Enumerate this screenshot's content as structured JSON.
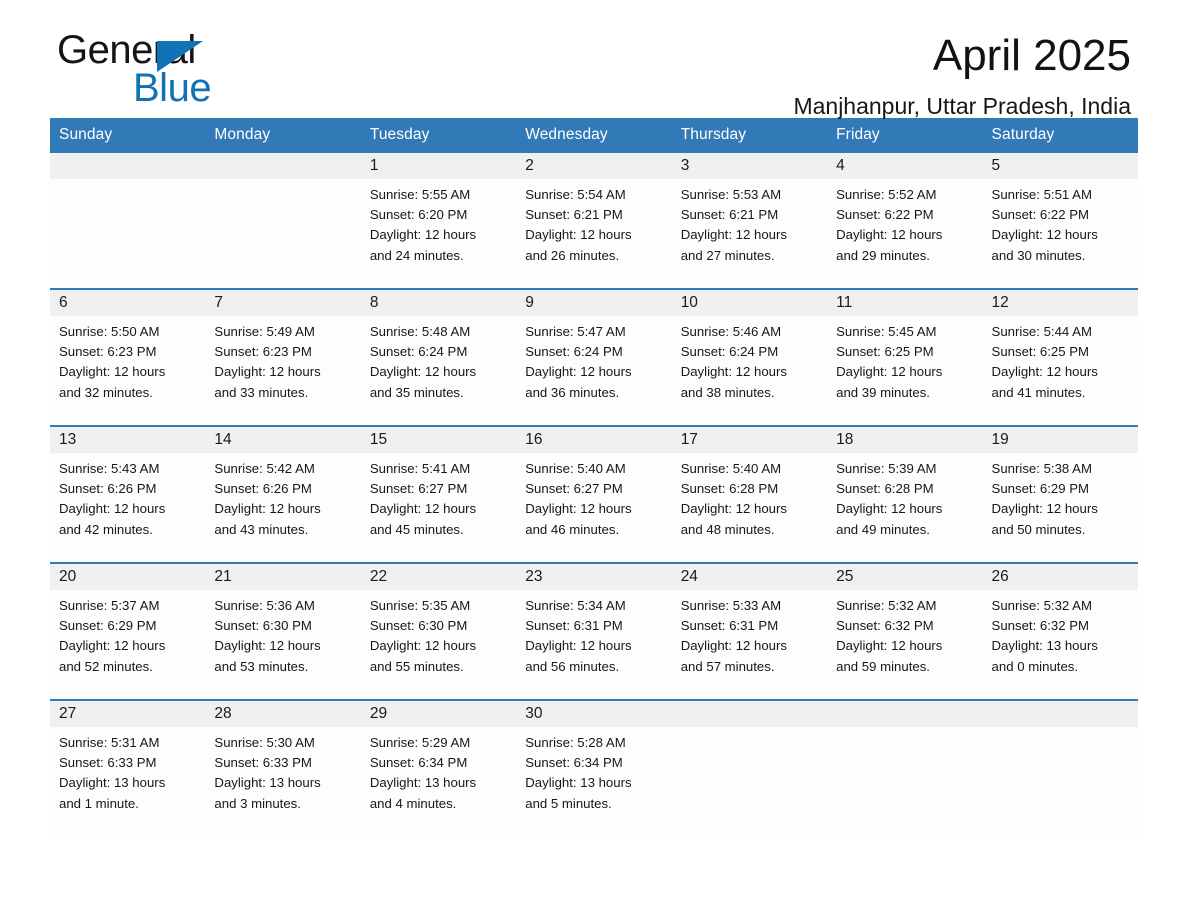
{
  "brand": {
    "name_part1": "General",
    "name_part2": "Blue",
    "flag_icon": "triangle-flag-icon",
    "accent_color": "#1272b6"
  },
  "header": {
    "month_title": "April 2025",
    "location": "Manjhanpur, Uttar Pradesh, India"
  },
  "theme": {
    "header_blue": "#3279b7",
    "daynum_band": "#f0f0f0",
    "cell_background": "#fdfdfd",
    "text": "#171717"
  },
  "calendar": {
    "weekday_headers": [
      "Sunday",
      "Monday",
      "Tuesday",
      "Wednesday",
      "Thursday",
      "Friday",
      "Saturday"
    ],
    "weeks": [
      [
        {
          "day": "",
          "sunrise": "",
          "sunset": "",
          "daylight_line1": "",
          "daylight_line2": ""
        },
        {
          "day": "",
          "sunrise": "",
          "sunset": "",
          "daylight_line1": "",
          "daylight_line2": ""
        },
        {
          "day": "1",
          "sunrise": "Sunrise: 5:55 AM",
          "sunset": "Sunset: 6:20 PM",
          "daylight_line1": "Daylight: 12 hours",
          "daylight_line2": "and 24 minutes."
        },
        {
          "day": "2",
          "sunrise": "Sunrise: 5:54 AM",
          "sunset": "Sunset: 6:21 PM",
          "daylight_line1": "Daylight: 12 hours",
          "daylight_line2": "and 26 minutes."
        },
        {
          "day": "3",
          "sunrise": "Sunrise: 5:53 AM",
          "sunset": "Sunset: 6:21 PM",
          "daylight_line1": "Daylight: 12 hours",
          "daylight_line2": "and 27 minutes."
        },
        {
          "day": "4",
          "sunrise": "Sunrise: 5:52 AM",
          "sunset": "Sunset: 6:22 PM",
          "daylight_line1": "Daylight: 12 hours",
          "daylight_line2": "and 29 minutes."
        },
        {
          "day": "5",
          "sunrise": "Sunrise: 5:51 AM",
          "sunset": "Sunset: 6:22 PM",
          "daylight_line1": "Daylight: 12 hours",
          "daylight_line2": "and 30 minutes."
        }
      ],
      [
        {
          "day": "6",
          "sunrise": "Sunrise: 5:50 AM",
          "sunset": "Sunset: 6:23 PM",
          "daylight_line1": "Daylight: 12 hours",
          "daylight_line2": "and 32 minutes."
        },
        {
          "day": "7",
          "sunrise": "Sunrise: 5:49 AM",
          "sunset": "Sunset: 6:23 PM",
          "daylight_line1": "Daylight: 12 hours",
          "daylight_line2": "and 33 minutes."
        },
        {
          "day": "8",
          "sunrise": "Sunrise: 5:48 AM",
          "sunset": "Sunset: 6:24 PM",
          "daylight_line1": "Daylight: 12 hours",
          "daylight_line2": "and 35 minutes."
        },
        {
          "day": "9",
          "sunrise": "Sunrise: 5:47 AM",
          "sunset": "Sunset: 6:24 PM",
          "daylight_line1": "Daylight: 12 hours",
          "daylight_line2": "and 36 minutes."
        },
        {
          "day": "10",
          "sunrise": "Sunrise: 5:46 AM",
          "sunset": "Sunset: 6:24 PM",
          "daylight_line1": "Daylight: 12 hours",
          "daylight_line2": "and 38 minutes."
        },
        {
          "day": "11",
          "sunrise": "Sunrise: 5:45 AM",
          "sunset": "Sunset: 6:25 PM",
          "daylight_line1": "Daylight: 12 hours",
          "daylight_line2": "and 39 minutes."
        },
        {
          "day": "12",
          "sunrise": "Sunrise: 5:44 AM",
          "sunset": "Sunset: 6:25 PM",
          "daylight_line1": "Daylight: 12 hours",
          "daylight_line2": "and 41 minutes."
        }
      ],
      [
        {
          "day": "13",
          "sunrise": "Sunrise: 5:43 AM",
          "sunset": "Sunset: 6:26 PM",
          "daylight_line1": "Daylight: 12 hours",
          "daylight_line2": "and 42 minutes."
        },
        {
          "day": "14",
          "sunrise": "Sunrise: 5:42 AM",
          "sunset": "Sunset: 6:26 PM",
          "daylight_line1": "Daylight: 12 hours",
          "daylight_line2": "and 43 minutes."
        },
        {
          "day": "15",
          "sunrise": "Sunrise: 5:41 AM",
          "sunset": "Sunset: 6:27 PM",
          "daylight_line1": "Daylight: 12 hours",
          "daylight_line2": "and 45 minutes."
        },
        {
          "day": "16",
          "sunrise": "Sunrise: 5:40 AM",
          "sunset": "Sunset: 6:27 PM",
          "daylight_line1": "Daylight: 12 hours",
          "daylight_line2": "and 46 minutes."
        },
        {
          "day": "17",
          "sunrise": "Sunrise: 5:40 AM",
          "sunset": "Sunset: 6:28 PM",
          "daylight_line1": "Daylight: 12 hours",
          "daylight_line2": "and 48 minutes."
        },
        {
          "day": "18",
          "sunrise": "Sunrise: 5:39 AM",
          "sunset": "Sunset: 6:28 PM",
          "daylight_line1": "Daylight: 12 hours",
          "daylight_line2": "and 49 minutes."
        },
        {
          "day": "19",
          "sunrise": "Sunrise: 5:38 AM",
          "sunset": "Sunset: 6:29 PM",
          "daylight_line1": "Daylight: 12 hours",
          "daylight_line2": "and 50 minutes."
        }
      ],
      [
        {
          "day": "20",
          "sunrise": "Sunrise: 5:37 AM",
          "sunset": "Sunset: 6:29 PM",
          "daylight_line1": "Daylight: 12 hours",
          "daylight_line2": "and 52 minutes."
        },
        {
          "day": "21",
          "sunrise": "Sunrise: 5:36 AM",
          "sunset": "Sunset: 6:30 PM",
          "daylight_line1": "Daylight: 12 hours",
          "daylight_line2": "and 53 minutes."
        },
        {
          "day": "22",
          "sunrise": "Sunrise: 5:35 AM",
          "sunset": "Sunset: 6:30 PM",
          "daylight_line1": "Daylight: 12 hours",
          "daylight_line2": "and 55 minutes."
        },
        {
          "day": "23",
          "sunrise": "Sunrise: 5:34 AM",
          "sunset": "Sunset: 6:31 PM",
          "daylight_line1": "Daylight: 12 hours",
          "daylight_line2": "and 56 minutes."
        },
        {
          "day": "24",
          "sunrise": "Sunrise: 5:33 AM",
          "sunset": "Sunset: 6:31 PM",
          "daylight_line1": "Daylight: 12 hours",
          "daylight_line2": "and 57 minutes."
        },
        {
          "day": "25",
          "sunrise": "Sunrise: 5:32 AM",
          "sunset": "Sunset: 6:32 PM",
          "daylight_line1": "Daylight: 12 hours",
          "daylight_line2": "and 59 minutes."
        },
        {
          "day": "26",
          "sunrise": "Sunrise: 5:32 AM",
          "sunset": "Sunset: 6:32 PM",
          "daylight_line1": "Daylight: 13 hours",
          "daylight_line2": "and 0 minutes."
        }
      ],
      [
        {
          "day": "27",
          "sunrise": "Sunrise: 5:31 AM",
          "sunset": "Sunset: 6:33 PM",
          "daylight_line1": "Daylight: 13 hours",
          "daylight_line2": "and 1 minute."
        },
        {
          "day": "28",
          "sunrise": "Sunrise: 5:30 AM",
          "sunset": "Sunset: 6:33 PM",
          "daylight_line1": "Daylight: 13 hours",
          "daylight_line2": "and 3 minutes."
        },
        {
          "day": "29",
          "sunrise": "Sunrise: 5:29 AM",
          "sunset": "Sunset: 6:34 PM",
          "daylight_line1": "Daylight: 13 hours",
          "daylight_line2": "and 4 minutes."
        },
        {
          "day": "30",
          "sunrise": "Sunrise: 5:28 AM",
          "sunset": "Sunset: 6:34 PM",
          "daylight_line1": "Daylight: 13 hours",
          "daylight_line2": "and 5 minutes."
        },
        {
          "day": "",
          "sunrise": "",
          "sunset": "",
          "daylight_line1": "",
          "daylight_line2": ""
        },
        {
          "day": "",
          "sunrise": "",
          "sunset": "",
          "daylight_line1": "",
          "daylight_line2": ""
        },
        {
          "day": "",
          "sunrise": "",
          "sunset": "",
          "daylight_line1": "",
          "daylight_line2": ""
        }
      ]
    ]
  }
}
